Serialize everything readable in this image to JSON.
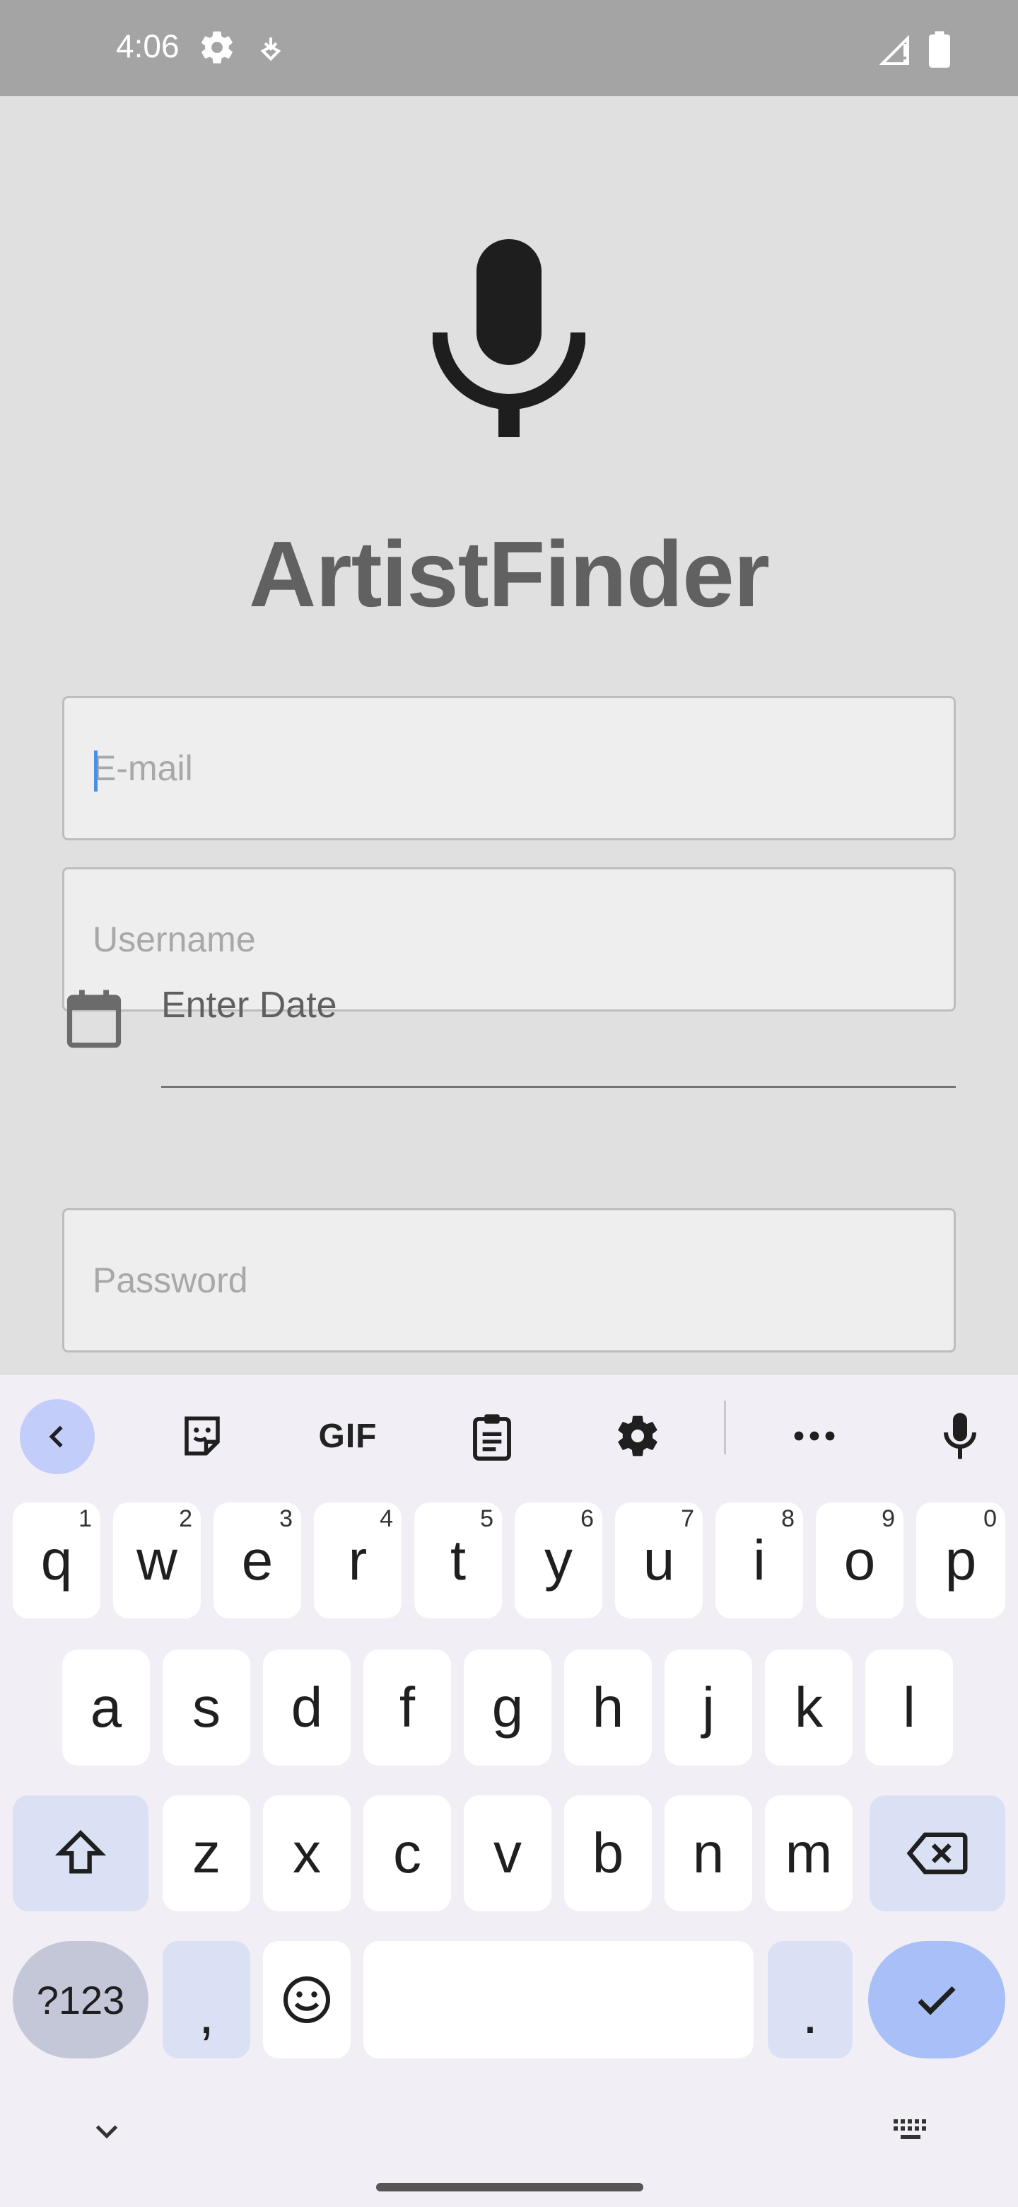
{
  "status_bar": {
    "time": "4:06",
    "icons": [
      "settings-gear-icon",
      "download-icon",
      "signal-icon",
      "battery-icon"
    ]
  },
  "app": {
    "logo_icon": "microphone-icon",
    "title": "ArtistFinder",
    "email": {
      "value": "",
      "placeholder": "E-mail"
    },
    "username": {
      "value": "",
      "placeholder": "Username"
    },
    "date": {
      "value": "",
      "placeholder": "Enter Date",
      "icon": "calendar-icon"
    },
    "password": {
      "value": "",
      "placeholder": "Password"
    }
  },
  "keyboard": {
    "toolbar": {
      "items": [
        "back-icon",
        "sticker-icon",
        "GIF",
        "clipboard-icon",
        "gear-icon",
        "more-icon",
        "mic-icon"
      ],
      "gif_label": "GIF"
    },
    "row1": [
      {
        "k": "q",
        "h": "1"
      },
      {
        "k": "w",
        "h": "2"
      },
      {
        "k": "e",
        "h": "3"
      },
      {
        "k": "r",
        "h": "4"
      },
      {
        "k": "t",
        "h": "5"
      },
      {
        "k": "y",
        "h": "6"
      },
      {
        "k": "u",
        "h": "7"
      },
      {
        "k": "i",
        "h": "8"
      },
      {
        "k": "o",
        "h": "9"
      },
      {
        "k": "p",
        "h": "0"
      }
    ],
    "row2": [
      "a",
      "s",
      "d",
      "f",
      "g",
      "h",
      "j",
      "k",
      "l"
    ],
    "row3": [
      "z",
      "x",
      "c",
      "v",
      "b",
      "n",
      "m"
    ],
    "row4": {
      "symbols": "?123",
      "comma": ",",
      "period": "."
    },
    "colors": {
      "background": "#f1eff5",
      "function_key": "#dbe1f5",
      "enter_key": "#a8c0f7",
      "symbols_key": "#c4c7d8"
    }
  }
}
